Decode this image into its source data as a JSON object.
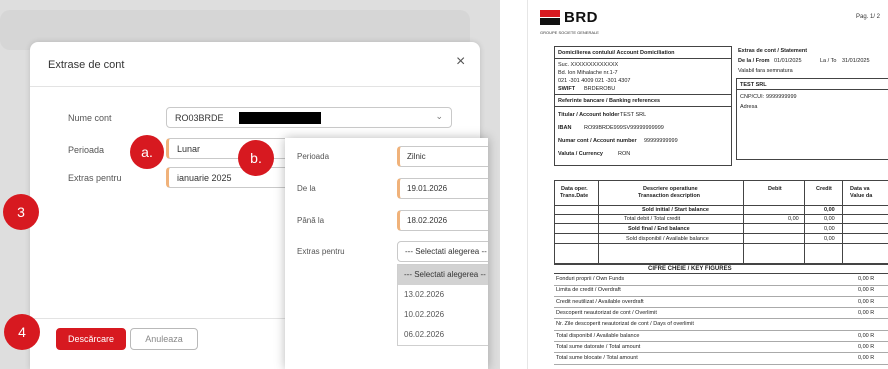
{
  "dialog": {
    "title": "Extrase de cont",
    "close_glyph": "×",
    "account_label": "Nume cont",
    "account_value": "RO03BRDE",
    "period_label": "Perioada",
    "period_value": "Lunar",
    "statement_for_label": "Extras pentru",
    "statement_for_value": "ianuarie 2025",
    "download_button": "Descărcare",
    "cancel_button": "Anuleaza"
  },
  "markers": {
    "a": "a.",
    "b": "b.",
    "three": "3",
    "four": "4"
  },
  "panel": {
    "period_label": "Perioada",
    "period_value": "Zilnic",
    "from_label": "De la",
    "from_value": "19.01.2026",
    "to_label": "Până la",
    "to_value": "18.02.2026",
    "statement_for_label": "Extras pentru",
    "statement_for_placeholder": "--- Selectati alegerea --",
    "options": [
      "--- Selectati alegerea --",
      "13.02.2026",
      "10.02.2026",
      "06.02.2026"
    ]
  },
  "statement": {
    "logo_text": "BRD",
    "logo_subtitle": "GROUPE SOCIETE GENERALE",
    "page": "Pag. 1/ 2",
    "domiciliation_title": "Domicilierea contului/ Account Domiciliation",
    "suc": "Suc. XXXXXXXXXXXXX",
    "address1": "Bd. Ion Mihalache nr.1-7",
    "phones": "021 -301 4009 021 -301 4307",
    "swift_label": "SWIFT",
    "swift_value": "BRDEROBU",
    "bank_refs_title": "Referinte bancare / Banking references",
    "holder_label": "Titular / Account holder",
    "holder_value": "TEST SRL",
    "iban_label": "IBAN",
    "iban_value": "RO99BRDE999SV99999999999",
    "account_no_label": "Numar cont / Account number",
    "account_no_value": "99999999999",
    "currency_label": "Valuta / Currency",
    "currency_value": "RON",
    "statement_title": "Extras de cont / Statement",
    "from_label": "De la / From",
    "from_value": "01/01/2025",
    "to_label": "La / To",
    "to_value": "31/01/2025",
    "valid_note": "Valabil fara semnatura",
    "company": "TEST SRL",
    "cnp_label": "CNP/CUI:",
    "cnp_value": "9999999999",
    "address_label": "Adresa",
    "col_date": "Data oper.",
    "col_date2": "Trans.Date",
    "col_desc": "Descriere operatiune",
    "col_desc2": "Transaction description",
    "col_debit": "Debit",
    "col_credit": "Credit",
    "col_value": "Data va",
    "col_value2": "Value da",
    "row_initial": "Sold initial / Start balance",
    "row_initial_credit": "0,00",
    "row_total": "Total debit / Total credit",
    "row_total_debit": "0,00",
    "row_total_credit": "0,00",
    "row_final": "Sold final / End balance",
    "row_final_credit": "0,00",
    "row_avail": "Sold disponibil / Available balance",
    "row_avail_credit": "0,00",
    "key_figures_title": "CIFRE CHEIE / KEY FIGURES",
    "key_figures": [
      {
        "label": "Fonduri proprii / Own Funds",
        "value": "0,00 R"
      },
      {
        "label": "Limita de credit / Overdraft",
        "value": "0,00 R"
      },
      {
        "label": "Credit neutilizat / Available overdraft",
        "value": "0,00 R"
      },
      {
        "label": "Descoperit neautorizat de cont / Overlimit",
        "value": "0,00 R"
      },
      {
        "label": "Nr. Zile descoperit neautorizat de cont / Days of overlimit",
        "value": ""
      },
      {
        "label": "Total disponibil / Available balance",
        "value": "0,00 R"
      },
      {
        "label": "Total sume datorate / Total amount",
        "value": "0,00 R"
      },
      {
        "label": "Total sume blocate / Total amount",
        "value": "0,00 R"
      }
    ]
  }
}
